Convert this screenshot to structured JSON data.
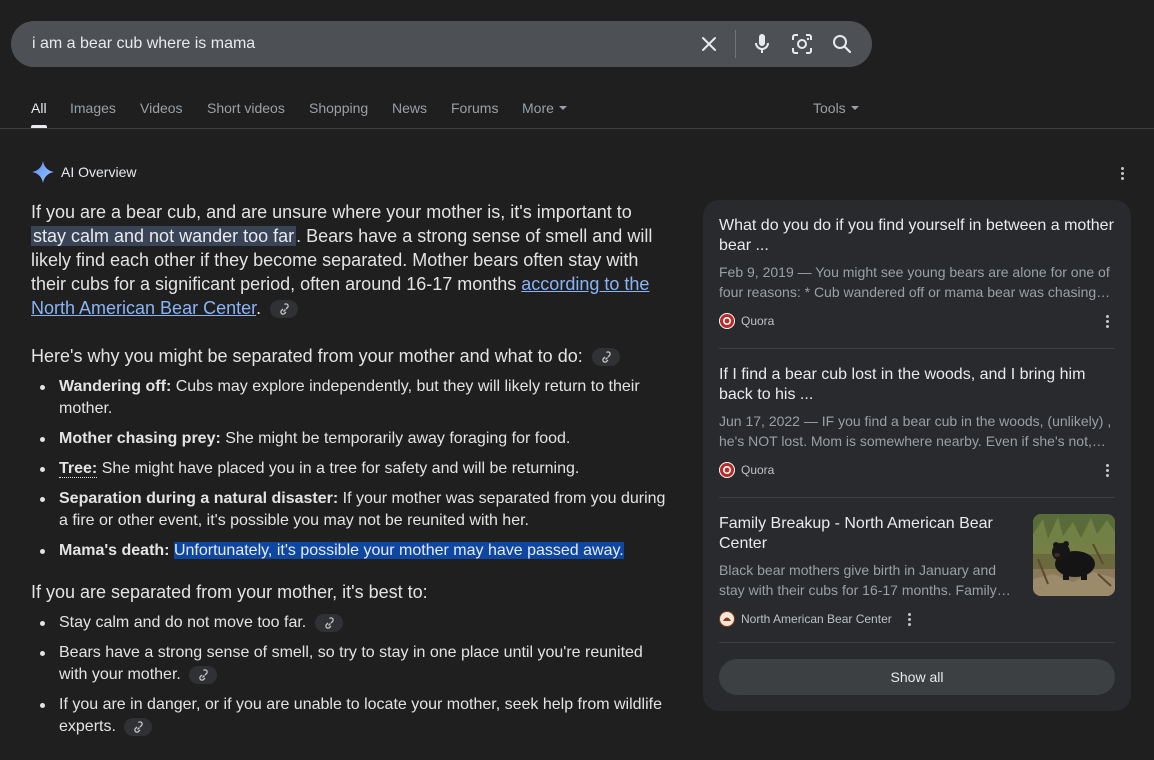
{
  "search": {
    "query": "i am a bear cub where is mama",
    "icons": [
      "close-icon",
      "mic-icon",
      "lens-icon",
      "search-icon"
    ]
  },
  "tabs": {
    "items": [
      "All",
      "Images",
      "Videos",
      "Short videos",
      "Shopping",
      "News",
      "Forums",
      "More"
    ],
    "active": "All",
    "tools": "Tools"
  },
  "ai_overview": {
    "label": "AI Overview",
    "intro": {
      "part1": "If you are a bear cub, and are unsure where your mother is, it's important to ",
      "highlight": "stay calm and not wander too far",
      "part2": ". Bears have a strong sense of smell and will likely find each other if they become separated. Mother bears often stay with their cubs for a significant period, often around 16-17 months ",
      "link": "according to the North American Bear Center",
      "part3": "."
    },
    "why_heading": "Here's why you might be separated from your mother and what to do:",
    "reasons": [
      {
        "term": "Wandering off:",
        "text": " Cubs may explore independently, but they will likely return to their mother."
      },
      {
        "term": "Mother chasing prey:",
        "text": " She might be temporarily away foraging for food."
      },
      {
        "term": "Tree:",
        "text": " She might have placed you in a tree for safety and will be returning."
      },
      {
        "term": "Separation during a natural disaster:",
        "text": " If your mother was separated from you during a fire or other event, it's possible you may not be reunited with her."
      },
      {
        "term": "Mama's death:",
        "text": "Unfortunately, it's possible your mother may have passed away."
      }
    ],
    "best_heading": "If you are separated from your mother, it's best to:",
    "tips": [
      "Stay calm and do not move too far.",
      "Bears have a strong sense of smell, so try to stay in one place until you're reunited with your mother.",
      "If you are in danger, or if you are unable to locate your mother, seek help from wildlife experts."
    ]
  },
  "sources": {
    "cards": [
      {
        "title": "What do you do if you find yourself in between a mother bear ...",
        "snippet": "Feb 9, 2019 — You might see young bears are alone for one of four reasons: * Cub wandered off or mama bear was chasing prey.",
        "source": "Quora",
        "fav_color": "#b92b27"
      },
      {
        "title": "If I find a bear cub lost in the woods, and I bring him back to his ...",
        "snippet": "Jun 17, 2022 — IF you find a bear cub in the woods, (unlikely) , he's NOT lost. Mom is somewhere nearby. Even if she's not, the cub will be fine.",
        "source": "Quora",
        "fav_color": "#b92b27"
      },
      {
        "title": "Family Breakup - North American Bear Center",
        "snippet": "Black bear mothers give birth in January and stay with their cubs for 16-17 months. Family breakup usually occurs in late May.",
        "source": "North American Bear Center",
        "fav_color": "#8b3a1a"
      }
    ],
    "show_all": "Show all"
  }
}
